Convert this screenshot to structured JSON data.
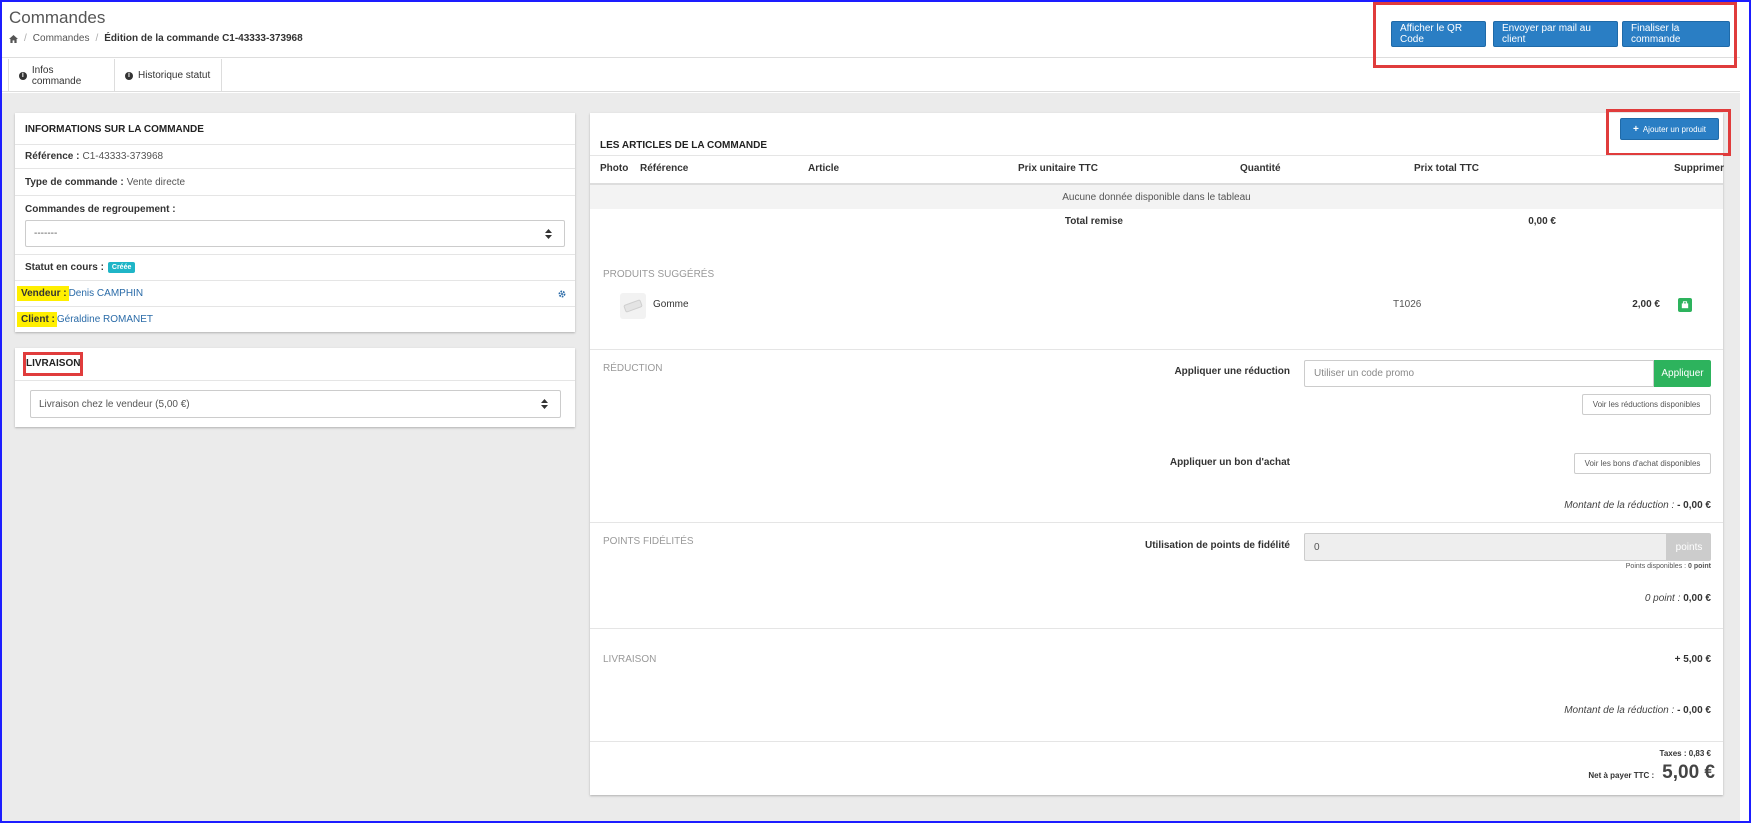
{
  "header": {
    "title": "Commandes",
    "breadcrumb": {
      "home_icon": "home-icon",
      "level1": "Commandes",
      "current": "Édition de la commande C1-43333-373968"
    },
    "actions": {
      "qr": "Afficher le QR Code",
      "mail": "Envoyer par mail au client",
      "finalize": "Finaliser la commande"
    }
  },
  "tabs": {
    "infos": "Infos commande",
    "history": "Historique statut"
  },
  "order_info": {
    "title": "INFORMATIONS SUR LA COMMANDE",
    "reference_label": "Référence :",
    "reference_value": "C1-43333-373968",
    "type_label": "Type de commande :",
    "type_value": "Vente directe",
    "grouping_label": "Commandes de regroupement :",
    "grouping_value": "-------",
    "status_label": "Statut en cours :",
    "status_badge": "Créée",
    "seller_label": "Vendeur :",
    "seller_value": "Denis CAMPHIN",
    "client_label": "Client :",
    "client_value": "Géraldine ROMANET"
  },
  "delivery": {
    "title": "LIVRAISON",
    "option": "Livraison chez le vendeur (5,00 €)"
  },
  "articles": {
    "title": "LES ARTICLES DE LA COMMANDE",
    "add_button": "Ajouter un produit",
    "columns": {
      "photo": "Photo",
      "reference": "Référence",
      "article": "Article",
      "unit_price": "Prix unitaire TTC",
      "quantity": "Quantité",
      "total_price": "Prix total TTC",
      "delete": "Supprimer"
    },
    "empty_message": "Aucune donnée disponible dans le tableau",
    "total_discount_label": "Total remise",
    "total_discount_value": "0,00 €"
  },
  "suggested": {
    "label": "PRODUITS SUGGÉRÉS",
    "product_name": "Gomme",
    "product_ref": "T1026",
    "product_price": "2,00 €"
  },
  "reduction": {
    "label": "RÉDUCTION",
    "apply_label": "Appliquer une réduction",
    "promo_placeholder": "Utiliser un code promo",
    "apply_button": "Appliquer",
    "view_reductions": "Voir les réductions disponibles",
    "voucher_label": "Appliquer un bon d'achat",
    "view_vouchers": "Voir les bons d'achat disponibles",
    "amount_label": "Montant de la réduction :",
    "amount_value": "- 0,00 €"
  },
  "loyalty": {
    "label": "POINTS FIDÉLITÉS",
    "use_label": "Utilisation de points de fidélité",
    "points_value": "0",
    "points_addon": "points",
    "available_label": "Points disponibles :",
    "available_value": "0 point",
    "summary_label": "0 point :",
    "summary_value": "0,00 €"
  },
  "shipping": {
    "label": "LIVRAISON",
    "amount": "+ 5,00 €",
    "reduction_label": "Montant de la réduction :",
    "reduction_value": "- 0,00 €"
  },
  "totals": {
    "taxes_label": "Taxes :",
    "taxes_value": "0,83 €",
    "net_label": "Net à payer TTC :",
    "net_value": "5,00 €"
  },
  "colors": {
    "primary": "#2a7ec4",
    "success": "#2db35d",
    "badge": "#1fb5c7",
    "highlight": "#ffef00",
    "annotation": "#e03c3c"
  }
}
